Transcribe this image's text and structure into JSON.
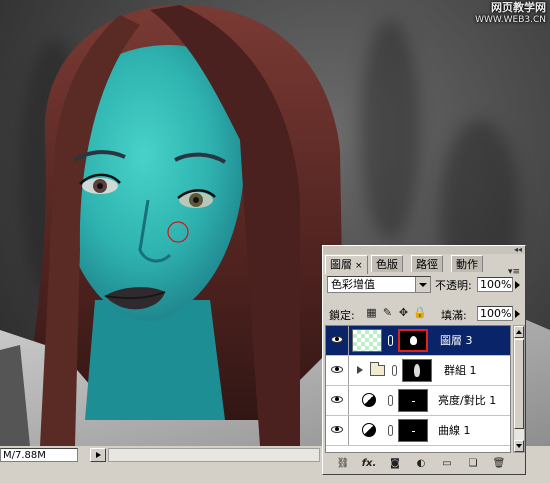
{
  "watermark": {
    "line1": "网页教学网",
    "line2": "WWW.WEB3.CN"
  },
  "status": {
    "doc_size": "M/7.88M"
  },
  "layers_panel": {
    "tabs": [
      {
        "label": "圖層",
        "close": "×"
      },
      {
        "label": "色版"
      },
      {
        "label": "路徑"
      },
      {
        "label": "動作"
      }
    ],
    "menu_icon": "▾≡",
    "blend_mode": "色彩增值",
    "opacity_label": "不透明:",
    "opacity_value": "100%",
    "lock_label": "鎖定:",
    "fill_label": "填滿:",
    "fill_value": "100%",
    "lock_icons": [
      "transparency-lock-icon",
      "brush-lock-icon",
      "move-lock-icon",
      "padlock-icon"
    ],
    "layers": [
      {
        "name": "圖層 3",
        "selected": true,
        "type": "pixel"
      },
      {
        "name": "群組 1",
        "selected": false,
        "type": "group"
      },
      {
        "name": "亮度/對比 1",
        "selected": false,
        "type": "adjustment"
      },
      {
        "name": "曲線 1",
        "selected": false,
        "type": "adjustment"
      }
    ],
    "bottom_buttons": [
      "link-icon",
      "fx-icon",
      "mask-icon",
      "adjustment-icon",
      "folder-icon",
      "new-layer-icon",
      "trash-icon"
    ],
    "bottom_fx_label": "fx."
  },
  "colors": {
    "selection": "#0a246a",
    "panel": "#d4d0c8",
    "skin": "#2fb3b0",
    "mask_border": "#e0221a"
  }
}
